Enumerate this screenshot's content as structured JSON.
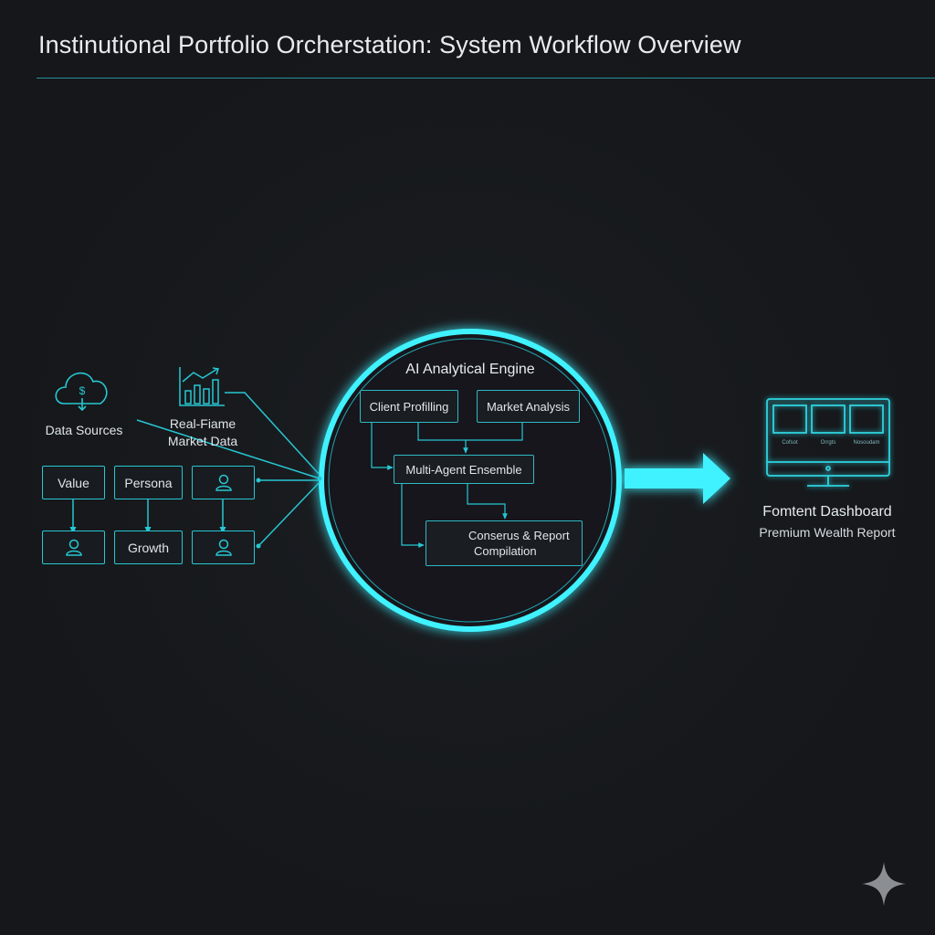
{
  "title": "Instinutional Portfolio Orcherstation: System Workflow Overview",
  "inputs": {
    "data_sources_label": "Data Sources",
    "market_data_line1": "Real-Fiame",
    "market_data_line2": "Market Data",
    "boxes": {
      "value": "Value",
      "persona": "Persona",
      "growth": "Growth"
    }
  },
  "engine": {
    "title": "AI Analytical Engine",
    "client_profiling": "Client Profilling",
    "market_analysis": "Market Analysis",
    "multi_agent": "Multi-Agent Ensemble",
    "consensus_line1": "Conserus & Report",
    "consensus_line2": "Compilation"
  },
  "output": {
    "title": "Fomtent Dashboard",
    "subtitle": "Premium Wealth Report",
    "screen_labels": [
      "Cofsot",
      "Orrgts",
      "Nosoudam"
    ]
  },
  "colors": {
    "accent": "#27c7d3",
    "glow": "#3ff2ff",
    "background": "#17191c",
    "text": "#dfe5ea"
  }
}
